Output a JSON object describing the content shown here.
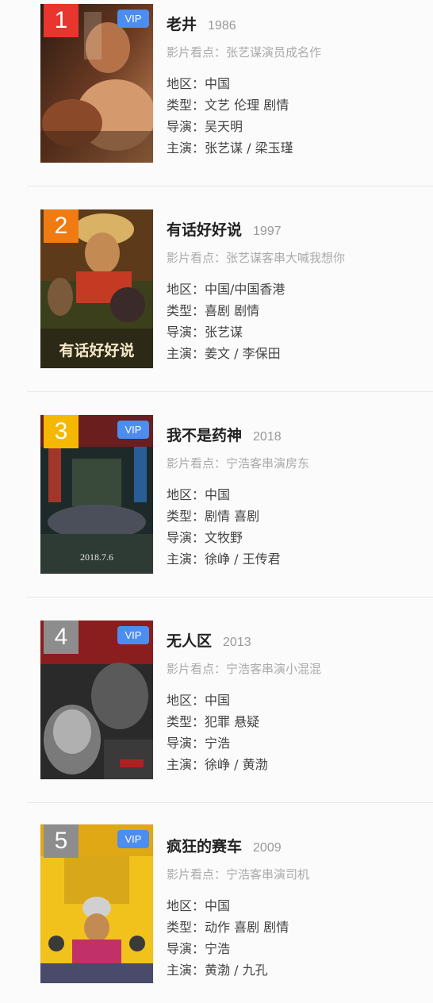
{
  "labels": {
    "highlight": "影片看点：",
    "region": "地区：",
    "genre": "类型：",
    "director": "导演：",
    "cast": "主演："
  },
  "colors": {
    "rank_1": "#e8352e",
    "rank_2": "#f07b12",
    "rank_3": "#f5b800",
    "rank_4": "#8d8d8d",
    "rank_5": "#8d8d8d",
    "vip": "#4b8df0"
  },
  "movies": [
    {
      "rank": "1",
      "vip": "VIP",
      "title": "老井",
      "year": "1986",
      "highlight": "张艺谋演员成名作",
      "region": "中国",
      "genre": "文艺 伦理 剧情",
      "director": "吴天明",
      "cast": "张艺谋 / 梁玉瑾"
    },
    {
      "rank": "2",
      "vip": "",
      "title": "有话好好说",
      "year": "1997",
      "highlight": "张艺谋客串大喊我想你",
      "region": "中国/中国香港",
      "genre": "喜剧 剧情",
      "director": "张艺谋",
      "cast": "姜文 / 李保田",
      "poster_title": "有话好好说"
    },
    {
      "rank": "3",
      "vip": "VIP",
      "title": "我不是药神",
      "year": "2018",
      "highlight": "宁浩客串演房东",
      "region": "中国",
      "genre": "剧情 喜剧",
      "director": "文牧野",
      "cast": "徐峥 / 王传君",
      "poster_date": "2018.7.6"
    },
    {
      "rank": "4",
      "vip": "VIP",
      "title": "无人区",
      "year": "2013",
      "highlight": "宁浩客串演小混混",
      "region": "中国",
      "genre": "犯罪 悬疑",
      "director": "宁浩",
      "cast": "徐峥 / 黄渤"
    },
    {
      "rank": "5",
      "vip": "VIP",
      "title": "疯狂的赛车",
      "year": "2009",
      "highlight": "宁浩客串演司机",
      "region": "中国",
      "genre": "动作 喜剧 剧情",
      "director": "宁浩",
      "cast": "黄渤 / 九孔"
    }
  ]
}
